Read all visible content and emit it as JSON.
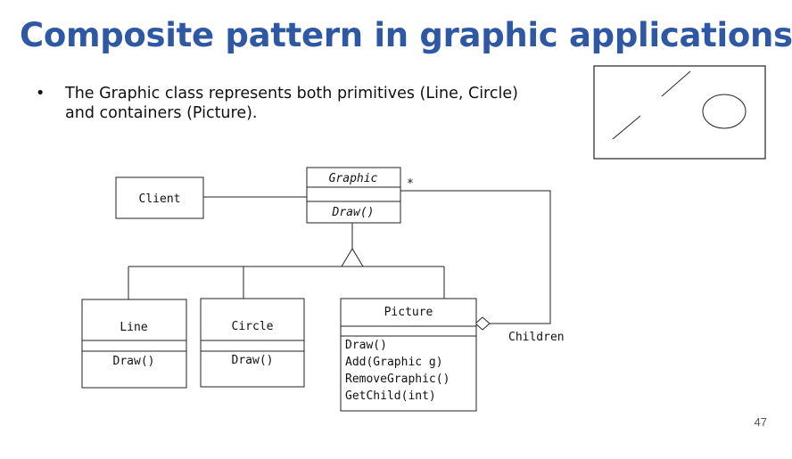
{
  "slide": {
    "title": "Composite pattern in graphic applications",
    "bullet": "The Graphic class represents both primitives (Line, Circle) and containers (Picture).",
    "page_number": "47"
  },
  "diagram": {
    "graphic": {
      "name": "Graphic",
      "operation": "Draw()"
    },
    "client": {
      "name": "Client"
    },
    "line": {
      "name": "Line",
      "operation": "Draw()"
    },
    "circle": {
      "name": "Circle",
      "operation": "Draw()"
    },
    "picture": {
      "name": "Picture",
      "operations": [
        "Draw()",
        "Add(Graphic g)",
        "RemoveGraphic()",
        "GetChild(int)"
      ]
    },
    "multiplicity": "*",
    "children_label": "Children"
  }
}
